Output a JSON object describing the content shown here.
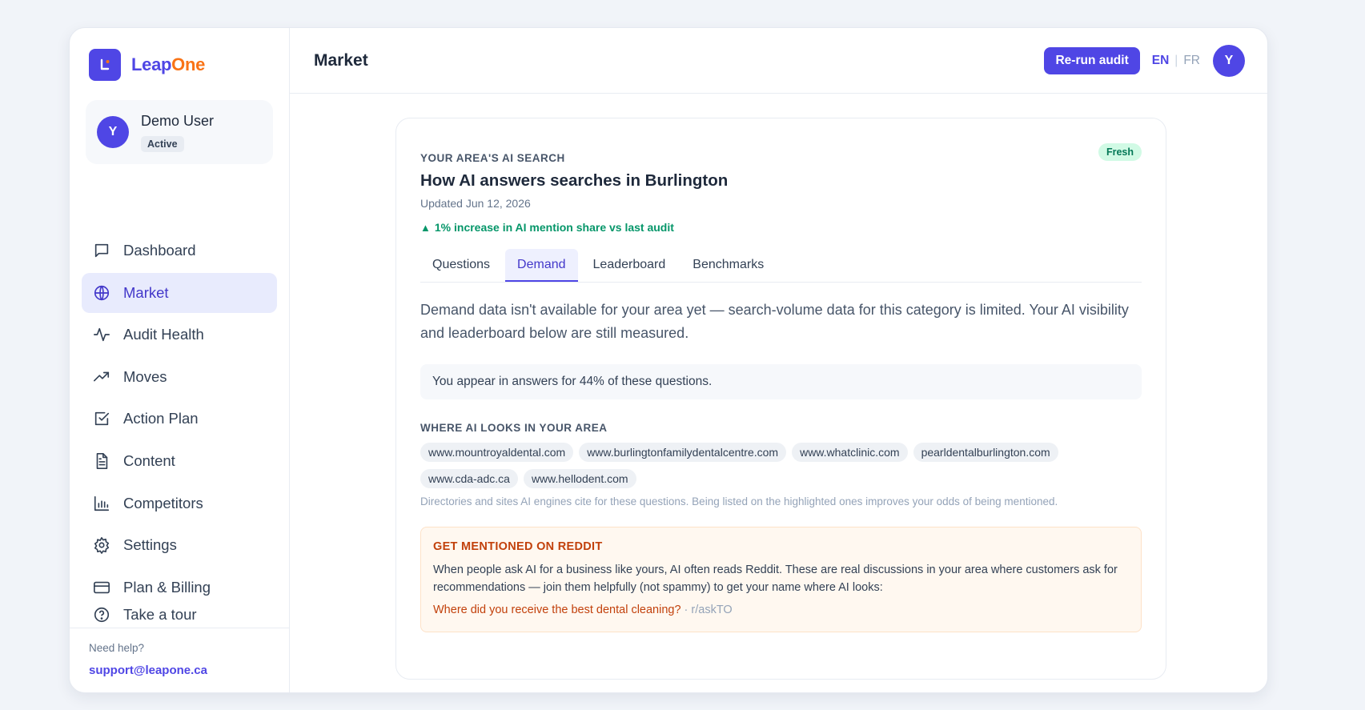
{
  "brand": {
    "name_part1": "Leap",
    "name_part2": "One",
    "mark": "L"
  },
  "user": {
    "initial": "Y",
    "name": "Demo User",
    "status": "Active"
  },
  "nav": [
    {
      "label": "Dashboard",
      "icon": "chat-icon"
    },
    {
      "label": "Market",
      "icon": "globe-icon",
      "active": true
    },
    {
      "label": "Audit Health",
      "icon": "pulse-icon"
    },
    {
      "label": "Moves",
      "icon": "trend-up-icon"
    },
    {
      "label": "Action Plan",
      "icon": "check-square-icon"
    },
    {
      "label": "Content",
      "icon": "document-icon"
    },
    {
      "label": "Competitors",
      "icon": "bar-chart-icon"
    },
    {
      "label": "Settings",
      "icon": "gear-icon"
    },
    {
      "label": "Plan & Billing",
      "icon": "credit-card-icon"
    }
  ],
  "tour": {
    "label": "Take a tour"
  },
  "footer": {
    "help": "Need help?",
    "email": "support@leapone.ca"
  },
  "topbar": {
    "title": "Market",
    "rerun": "Re-run audit",
    "lang_en": "EN",
    "lang_sep": "|",
    "lang_fr": "FR",
    "avatar": "Y"
  },
  "card": {
    "eyebrow": "YOUR AREA'S AI SEARCH",
    "badge": "Fresh",
    "title": "How AI answers searches in Burlington",
    "updated": "Updated Jun 12, 2026",
    "trend_arrow": "▲",
    "trend": "1% increase in AI mention share vs last audit",
    "tabs": [
      {
        "label": "Questions"
      },
      {
        "label": "Demand",
        "active": true
      },
      {
        "label": "Leaderboard"
      },
      {
        "label": "Benchmarks"
      }
    ],
    "demand_message": "Demand data isn't available for your area yet — search-volume data for this category is limited. Your AI visibility and leaderboard below are still measured.",
    "appear": "You appear in answers for 44% of these questions.",
    "where_title": "WHERE AI LOOKS IN YOUR AREA",
    "domains": [
      "www.mountroyaldental.com",
      "www.burlingtonfamilydentalcentre.com",
      "www.whatclinic.com",
      "pearldentalburlington.com",
      "www.cda-adc.ca",
      "www.hellodent.com"
    ],
    "directories_note": "Directories and sites AI engines cite for these questions. Being listed on the highlighted ones improves your odds of being mentioned.",
    "reddit": {
      "title": "GET MENTIONED ON REDDIT",
      "body": "When people ask AI for a business like yours, AI often reads Reddit. These are real discussions in your area where customers ask for recommendations — join them helpfully (not spammy) to get your name where AI looks:",
      "thread": "Where did you receive the best dental cleaning?",
      "subreddit": " · r/askTO"
    }
  },
  "colors": {
    "accent": "#4f46e5",
    "brand_orange": "#f97316",
    "success": "#059669",
    "reddit": "#c2410c"
  }
}
